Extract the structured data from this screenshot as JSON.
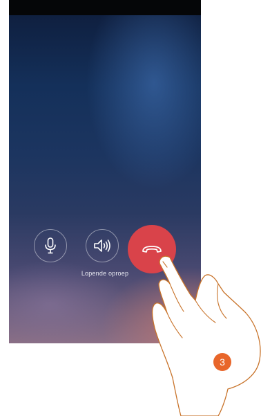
{
  "call": {
    "status_text": "Lopende oproep"
  },
  "controls": {
    "mic_icon": "microphone-icon",
    "speaker_icon": "speaker-icon",
    "hangup_icon": "hang-up-phone-icon",
    "hangup_color": "#d9434a"
  },
  "annotation": {
    "step_number": "3",
    "badge_color": "#e8662a",
    "hand_icon": "pointing-hand-icon"
  }
}
